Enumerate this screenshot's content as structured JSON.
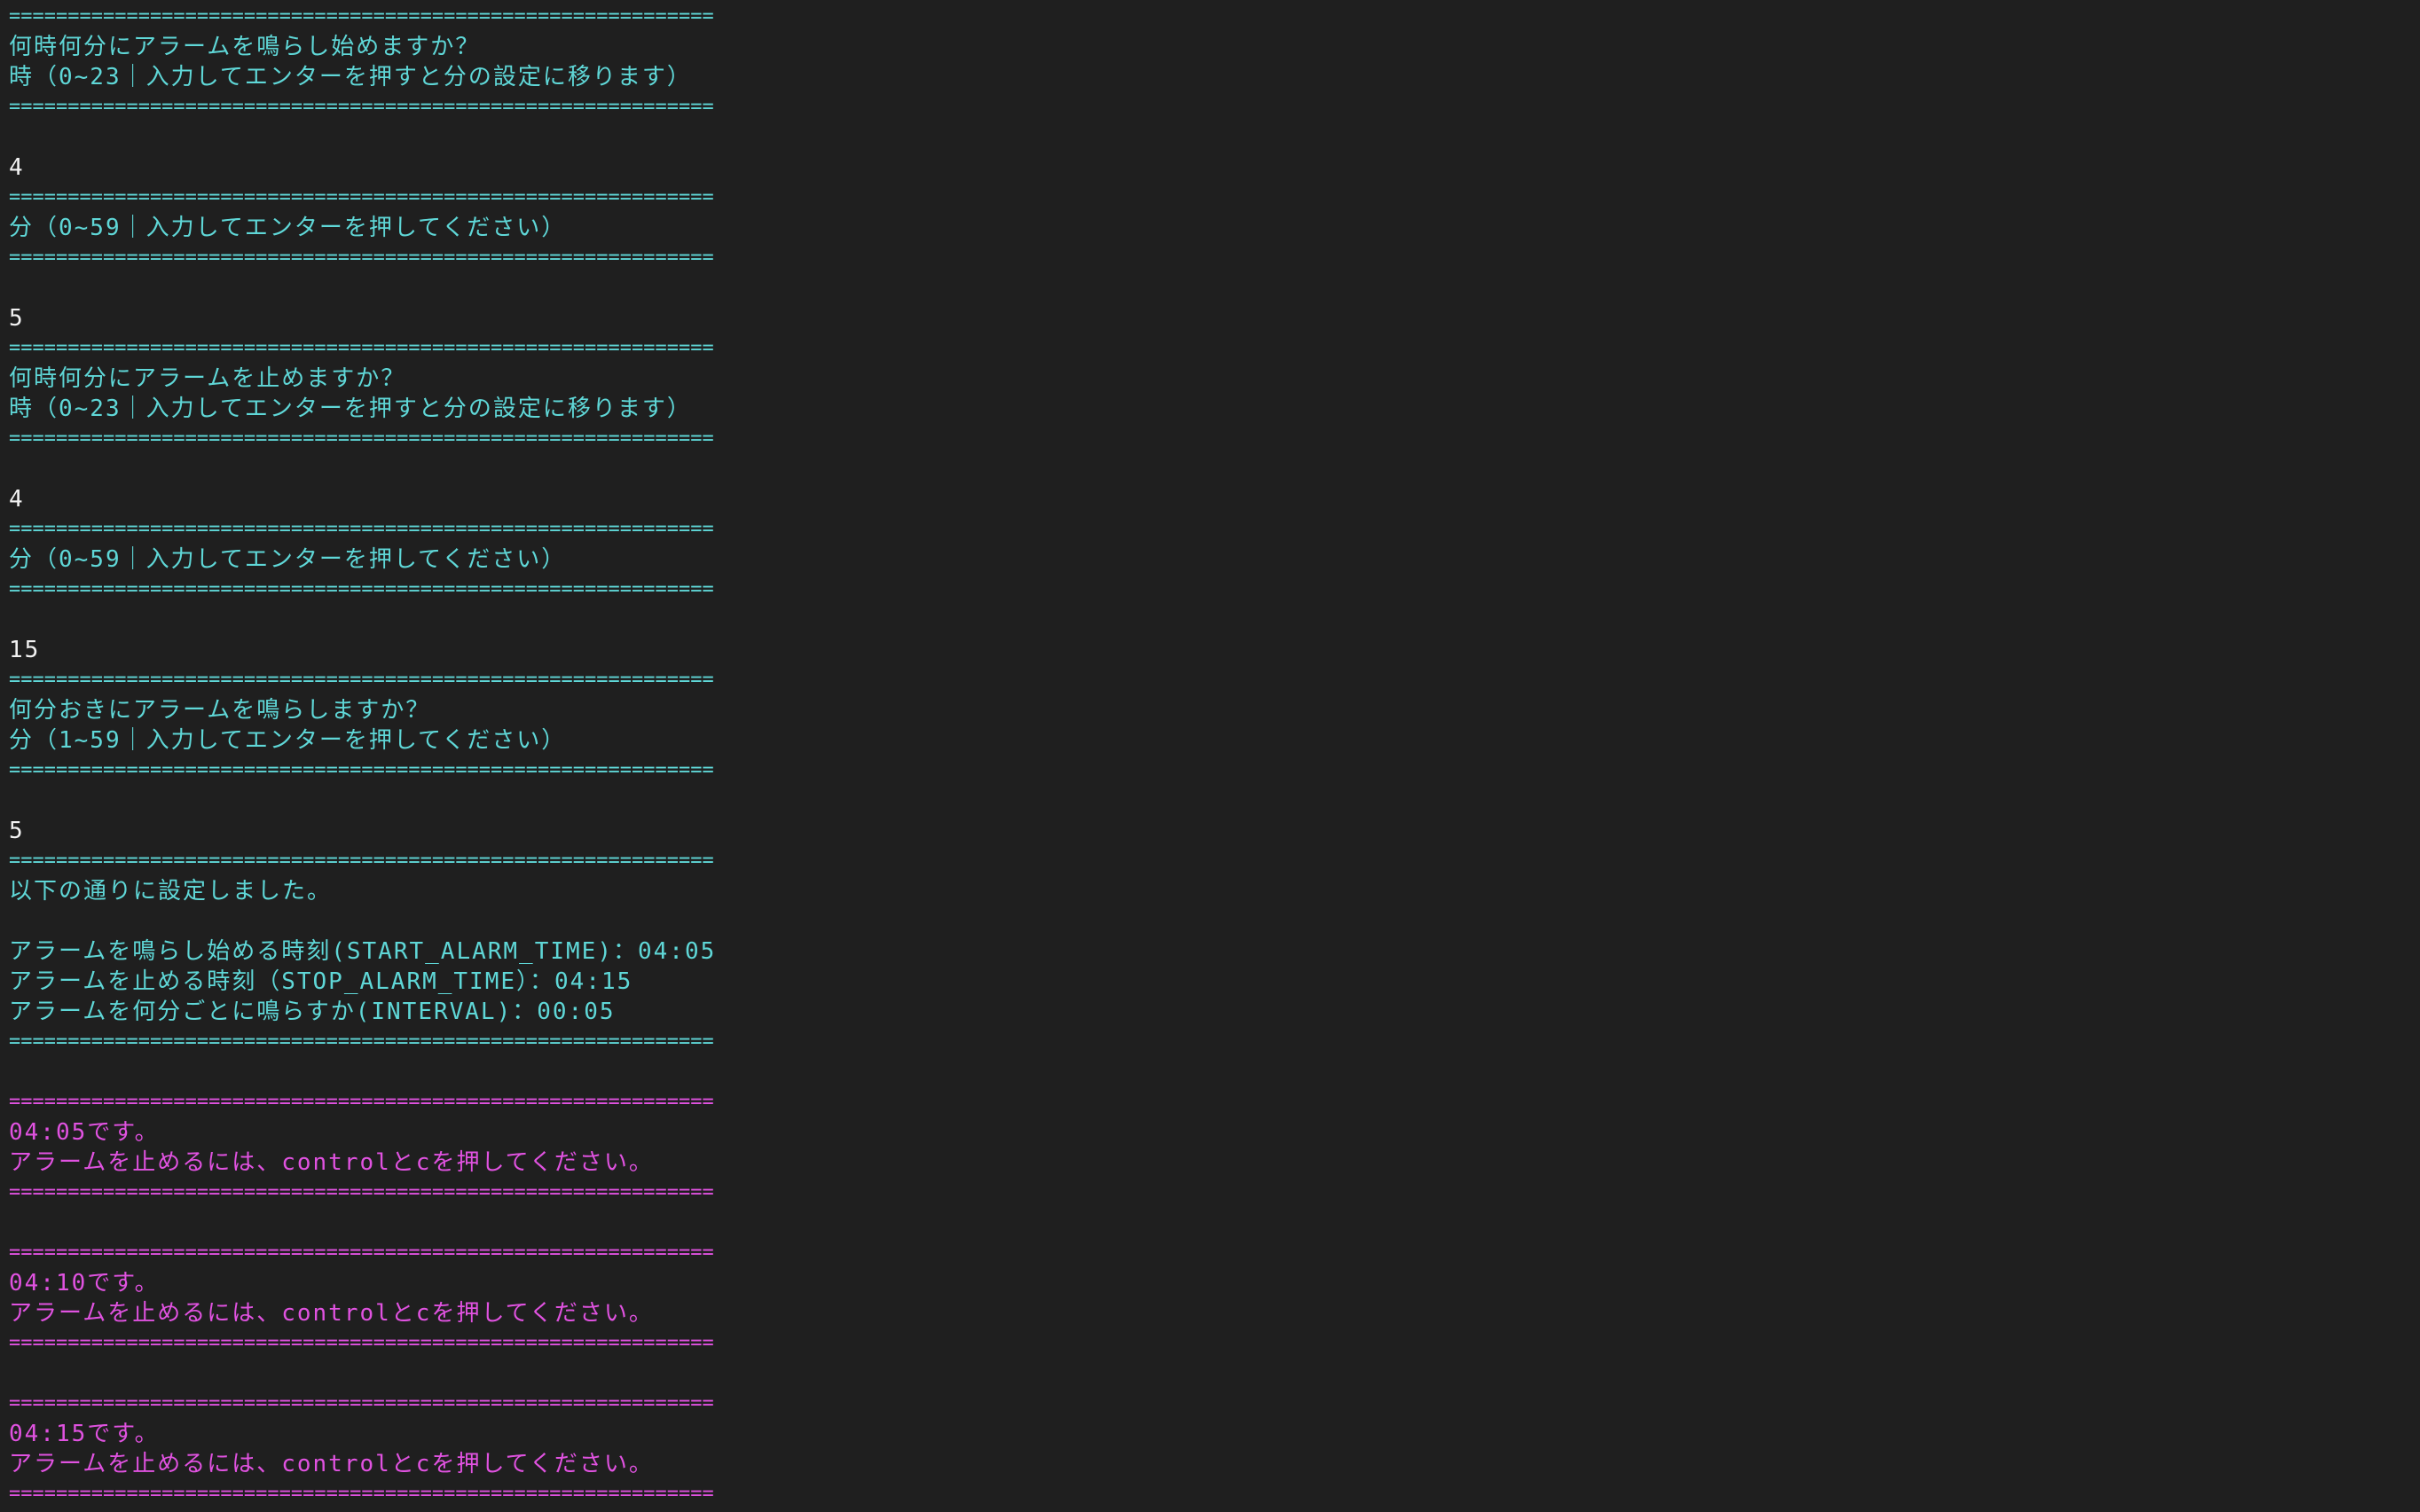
{
  "colors": {
    "background": "#1f1f1f",
    "prompt_text": "#5fd7d7",
    "user_input": "#f2f2f2",
    "alarm_text": "#e052e0"
  },
  "lines": [
    {
      "text": "============================================================",
      "kind": "sep",
      "color": "cyan"
    },
    {
      "text": "何時何分にアラームを鳴らし始めますか？",
      "kind": "text",
      "color": "cyan"
    },
    {
      "text": "時（0~23｜入力してエンターを押すと分の設定に移ります）",
      "kind": "text",
      "color": "cyan"
    },
    {
      "text": "============================================================",
      "kind": "sep",
      "color": "cyan"
    },
    {
      "text": "",
      "kind": "blank",
      "color": "cyan"
    },
    {
      "text": "4",
      "kind": "input",
      "color": "white"
    },
    {
      "text": "============================================================",
      "kind": "sep",
      "color": "cyan"
    },
    {
      "text": "分（0~59｜入力してエンターを押してください）",
      "kind": "text",
      "color": "cyan"
    },
    {
      "text": "============================================================",
      "kind": "sep",
      "color": "cyan"
    },
    {
      "text": "",
      "kind": "blank",
      "color": "cyan"
    },
    {
      "text": "5",
      "kind": "input",
      "color": "white"
    },
    {
      "text": "============================================================",
      "kind": "sep",
      "color": "cyan"
    },
    {
      "text": "何時何分にアラームを止めますか？",
      "kind": "text",
      "color": "cyan"
    },
    {
      "text": "時（0~23｜入力してエンターを押すと分の設定に移ります）",
      "kind": "text",
      "color": "cyan"
    },
    {
      "text": "============================================================",
      "kind": "sep",
      "color": "cyan"
    },
    {
      "text": "",
      "kind": "blank",
      "color": "cyan"
    },
    {
      "text": "4",
      "kind": "input",
      "color": "white"
    },
    {
      "text": "============================================================",
      "kind": "sep",
      "color": "cyan"
    },
    {
      "text": "分（0~59｜入力してエンターを押してください）",
      "kind": "text",
      "color": "cyan"
    },
    {
      "text": "============================================================",
      "kind": "sep",
      "color": "cyan"
    },
    {
      "text": "",
      "kind": "blank",
      "color": "cyan"
    },
    {
      "text": "15",
      "kind": "input",
      "color": "white"
    },
    {
      "text": "============================================================",
      "kind": "sep",
      "color": "cyan"
    },
    {
      "text": "何分おきにアラームを鳴らしますか？",
      "kind": "text",
      "color": "cyan"
    },
    {
      "text": "分（1~59｜入力してエンターを押してください）",
      "kind": "text",
      "color": "cyan"
    },
    {
      "text": "============================================================",
      "kind": "sep",
      "color": "cyan"
    },
    {
      "text": "",
      "kind": "blank",
      "color": "cyan"
    },
    {
      "text": "5",
      "kind": "input",
      "color": "white"
    },
    {
      "text": "============================================================",
      "kind": "sep",
      "color": "cyan"
    },
    {
      "text": "以下の通りに設定しました。",
      "kind": "text",
      "color": "cyan"
    },
    {
      "text": "",
      "kind": "blank",
      "color": "cyan"
    },
    {
      "text": "アラームを鳴らし始める時刻(START_ALARM_TIME)：04:05",
      "kind": "text",
      "color": "cyan"
    },
    {
      "text": "アラームを止める時刻（STOP_ALARM_TIME）：04:15",
      "kind": "text",
      "color": "cyan"
    },
    {
      "text": "アラームを何分ごとに鳴らすか(INTERVAL)：00:05",
      "kind": "text",
      "color": "cyan"
    },
    {
      "text": "============================================================",
      "kind": "sep",
      "color": "cyan"
    },
    {
      "text": "",
      "kind": "blank",
      "color": "cyan"
    },
    {
      "text": "============================================================",
      "kind": "sep",
      "color": "magenta"
    },
    {
      "text": "04:05です。",
      "kind": "text",
      "color": "magenta"
    },
    {
      "text": "アラームを止めるには、controlとcを押してください。",
      "kind": "text",
      "color": "magenta"
    },
    {
      "text": "============================================================",
      "kind": "sep",
      "color": "magenta"
    },
    {
      "text": "",
      "kind": "blank",
      "color": "magenta"
    },
    {
      "text": "============================================================",
      "kind": "sep",
      "color": "magenta"
    },
    {
      "text": "04:10です。",
      "kind": "text",
      "color": "magenta"
    },
    {
      "text": "アラームを止めるには、controlとcを押してください。",
      "kind": "text",
      "color": "magenta"
    },
    {
      "text": "============================================================",
      "kind": "sep",
      "color": "magenta"
    },
    {
      "text": "",
      "kind": "blank",
      "color": "magenta"
    },
    {
      "text": "============================================================",
      "kind": "sep",
      "color": "magenta"
    },
    {
      "text": "04:15です。",
      "kind": "text",
      "color": "magenta"
    },
    {
      "text": "アラームを止めるには、controlとcを押してください。",
      "kind": "text",
      "color": "magenta"
    },
    {
      "text": "============================================================",
      "kind": "sep",
      "color": "magenta"
    }
  ]
}
